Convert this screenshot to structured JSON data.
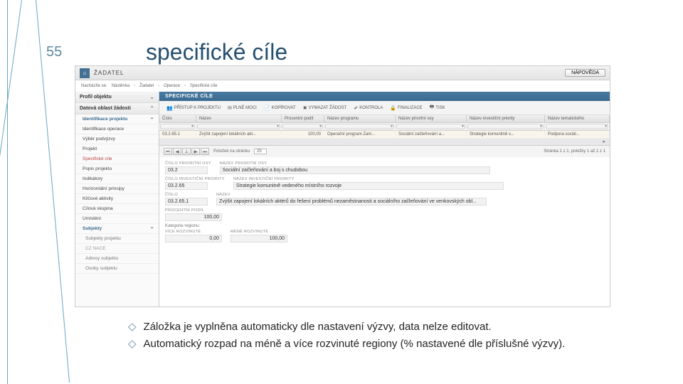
{
  "slide": {
    "number": "55",
    "title": "specifické cíle"
  },
  "topbar": {
    "tab": "ŽADATEL",
    "help": "NÁPOVĚDA"
  },
  "breadcrumb": {
    "label": "Nacházíte se:",
    "items": [
      "Nástěnka",
      "Žadatel",
      "Operace",
      "Specifické cíle"
    ]
  },
  "sidebar": {
    "profile": "Profil objektu",
    "data_area": "Datová oblast žádosti",
    "ident": "Identifikace projektu",
    "items": [
      "Identifikace operace",
      "Výběr podvýzvy",
      "Projekt",
      "Specifické cíle",
      "Popis projektu",
      "Indikátory",
      "Horizontální principy",
      "Klíčové aktivity",
      "Cílová skupina",
      "Umístění"
    ],
    "subjects": "Subjekty",
    "sub_items": [
      "Subjekty projektu",
      "CZ NACE",
      "Adresy subjektu",
      "Osoby subjektu"
    ]
  },
  "section_title": "SPECIFICKÉ CÍLE",
  "toolbar": {
    "access": "PŘÍSTUP K PROJEKTU",
    "powers": "PLNÉ MOCI",
    "copy": "KOPÍROVAT",
    "delete": "VYMAZAT ŽÁDOST",
    "check": "KONTROLA",
    "finalize": "FINALIZACE",
    "print": "TISK"
  },
  "grid": {
    "headers": [
      "Číslo",
      "Název",
      "Procentní podíl",
      "Název programu",
      "Název prioritní osy",
      "Název investiční priority",
      "Název tematického"
    ],
    "row": {
      "num": "03.2.65.1",
      "name": "Zvýšit zapojení lokálních akt...",
      "pct": "100,00",
      "prog": "Operační program Zam...",
      "axis": "Sociální začleňování a...",
      "prio": "Strategie komunitně v...",
      "theme": "Podpora sociál..."
    }
  },
  "pager": {
    "label": "Položek na stránku",
    "sel": "25",
    "info": "Stránka 1 z 1, položky 1 až 1 z 1"
  },
  "form": {
    "l_axis_num": "ČÍSLO PRIORITNÍ OSY",
    "axis_num": "03.2",
    "l_axis_name": "NÁZEV PRIORITNÍ OSY",
    "axis_name": "Sociální začleňování a boj s chudobou",
    "l_ip_num": "ČÍSLO INVESTIČNÍ PRIORITY",
    "ip_num": "03.2.65",
    "l_ip_name": "NÁZEV INVESTIČNÍ PRIORITY",
    "ip_name": "Strategie komunitně vedeného místního rozvoje",
    "l_num": "ČÍSLO",
    "num": "03.2.65.1",
    "l_name": "NÁZEV",
    "name": "Zvýšit zapojení lokálních aktérů do řešení problémů nezaměstnanosti a sociálního začleňování ve venkovských obl...",
    "l_pct": "PROCENTNÍ PODÍL",
    "pct": "100,00",
    "l_region": "Kategorie regionu:",
    "l_more": "VÍCE ROZVINUTÉ",
    "more": "0,00",
    "l_less": "MÉNĚ ROZVINUTÉ",
    "less": "100,00"
  },
  "notes": {
    "b1": "Záložka je vyplněna automaticky dle nastavení výzvy, data nelze editovat.",
    "b2": "Automatický rozpad na méně a více rozvinuté regiony (% nastavené dle příslušné výzvy)."
  }
}
